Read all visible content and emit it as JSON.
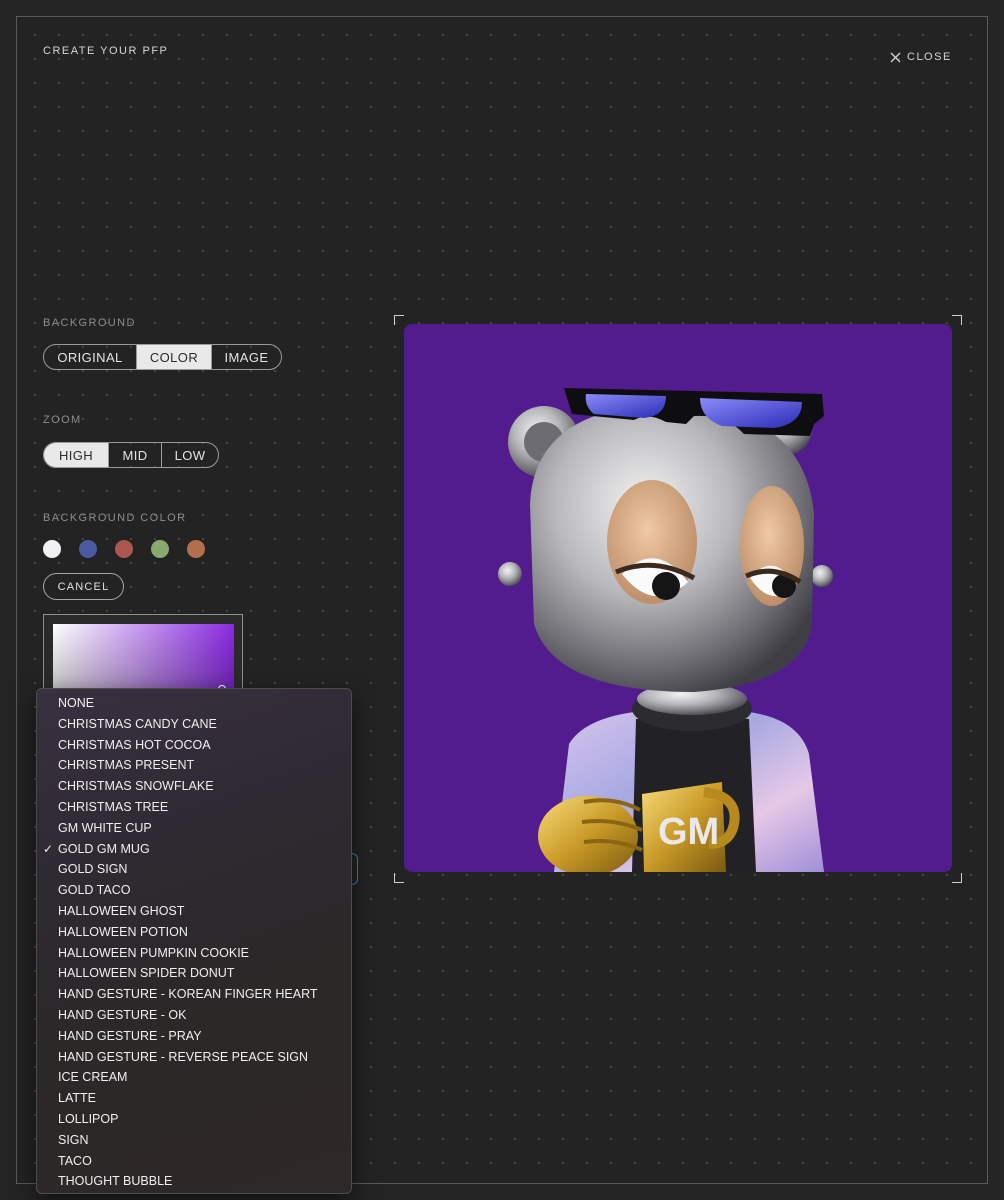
{
  "header": {
    "title": "CREATE YOUR PFP",
    "close_label": "CLOSE"
  },
  "background": {
    "label": "BACKGROUND",
    "options": [
      "ORIGINAL",
      "COLOR",
      "IMAGE"
    ],
    "selected": "COLOR"
  },
  "zoom": {
    "label": "ZOOM",
    "options": [
      "HIGH",
      "MID",
      "LOW"
    ],
    "selected": "HIGH"
  },
  "background_color": {
    "label": "BACKGROUND COLOR",
    "swatches": [
      "#f2f2f4",
      "#4a5aa0",
      "#a9574f",
      "#8aa971",
      "#b46e4d"
    ],
    "cancel_label": "CANCEL"
  },
  "prop_menu": {
    "items": [
      "NONE",
      "CHRISTMAS CANDY CANE",
      "CHRISTMAS HOT COCOA",
      "CHRISTMAS PRESENT",
      "CHRISTMAS SNOWFLAKE",
      "CHRISTMAS TREE",
      "GM WHITE CUP",
      "GOLD GM MUG",
      "GOLD SIGN",
      "GOLD TACO",
      "HALLOWEEN GHOST",
      "HALLOWEEN POTION",
      "HALLOWEEN PUMPKIN COOKIE",
      "HALLOWEEN SPIDER DONUT",
      "HAND GESTURE - KOREAN FINGER HEART",
      "HAND GESTURE - OK",
      "HAND GESTURE - PRAY",
      "HAND GESTURE - REVERSE PEACE SIGN",
      "ICE CREAM",
      "LATTE",
      "LOLLIPOP",
      "SIGN",
      "TACO",
      "THOUGHT BUBBLE"
    ],
    "selected": "GOLD GM MUG",
    "check_glyph": "✓"
  },
  "preview": {
    "background_color": "#521c8e",
    "mug_text": "GM"
  }
}
